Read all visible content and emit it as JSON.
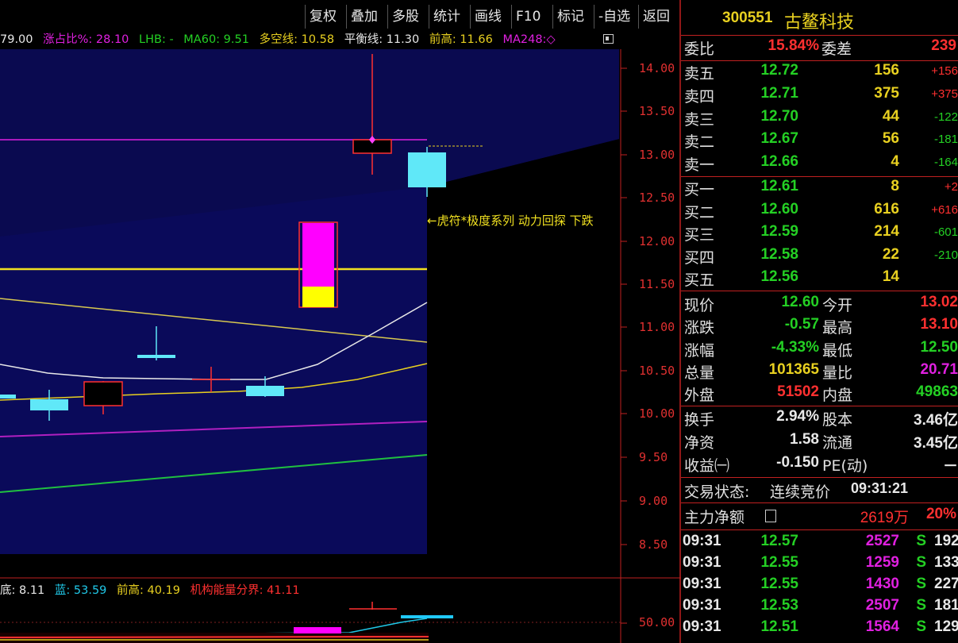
{
  "toolbar": [
    "复权",
    "叠加",
    "多股",
    "统计",
    "画线",
    "F10",
    "标记",
    "-自选",
    "返回"
  ],
  "indicator_top": [
    {
      "text": "79.00",
      "color": "#e8e8e8"
    },
    {
      "text": "涨占比%: 28.10",
      "color": "#e020e0"
    },
    {
      "text": "LHB: -",
      "color": "#24d024"
    },
    {
      "text": "MA60: 9.51",
      "color": "#24d024"
    },
    {
      "text": "多空线: 10.58",
      "color": "#e8d020"
    },
    {
      "text": "平衡线: 11.30",
      "color": "#e8e8e8"
    },
    {
      "text": "前高: 11.66",
      "color": "#e8d020"
    },
    {
      "text": "MA248:◇",
      "color": "#e020e0"
    }
  ],
  "price_ticks": [
    "14.00",
    "13.50",
    "13.00",
    "12.50",
    "12.00",
    "11.50",
    "11.00",
    "10.50",
    "10.00",
    "9.50",
    "9.00",
    "8.50"
  ],
  "lower_tick": "50.00",
  "annotation": "←虎符*极度系列 动力回探 下跌",
  "indicator_bottom": [
    {
      "text": "底: 8.11",
      "color": "#e8e8e8"
    },
    {
      "text": "蓝: 53.59",
      "color": "#20c8e8"
    },
    {
      "text": "前高: 40.19",
      "color": "#e8d020"
    },
    {
      "text": "机构能量分界: 41.11",
      "color": "#ff3030"
    }
  ],
  "stock": {
    "code": "300551",
    "name": "古鳌科技"
  },
  "weibi": {
    "label1": "委比",
    "value1": "15.84%",
    "label2": "委差",
    "value2": "239"
  },
  "sell": [
    {
      "label": "卖五",
      "price": "12.72",
      "vol": "156",
      "chg": "+156"
    },
    {
      "label": "卖四",
      "price": "12.71",
      "vol": "375",
      "chg": "+375"
    },
    {
      "label": "卖三",
      "price": "12.70",
      "vol": "44",
      "chg": "-122"
    },
    {
      "label": "卖二",
      "price": "12.67",
      "vol": "56",
      "chg": "-181"
    },
    {
      "label": "卖一",
      "price": "12.66",
      "vol": "4",
      "chg": "-164"
    }
  ],
  "buy": [
    {
      "label": "买一",
      "price": "12.61",
      "vol": "8",
      "chg": "+2"
    },
    {
      "label": "买二",
      "price": "12.60",
      "vol": "616",
      "chg": "+616"
    },
    {
      "label": "买三",
      "price": "12.59",
      "vol": "214",
      "chg": "-601"
    },
    {
      "label": "买四",
      "price": "12.58",
      "vol": "22",
      "chg": "-210"
    },
    {
      "label": "买五",
      "price": "12.56",
      "vol": "14",
      "chg": ""
    }
  ],
  "stats": [
    {
      "l1": "现价",
      "v1": "12.60",
      "c1": "green",
      "l2": "今开",
      "v2": "13.02",
      "c2": "red"
    },
    {
      "l1": "涨跌",
      "v1": "-0.57",
      "c1": "green",
      "l2": "最高",
      "v2": "13.10",
      "c2": "red"
    },
    {
      "l1": "涨幅",
      "v1": "-4.33%",
      "c1": "green",
      "l2": "最低",
      "v2": "12.50",
      "c2": "green"
    },
    {
      "l1": "总量",
      "v1": "101365",
      "c1": "yellow",
      "l2": "量比",
      "v2": "20.71",
      "c2": "magenta"
    },
    {
      "l1": "外盘",
      "v1": "51502",
      "c1": "red",
      "l2": "内盘",
      "v2": "49863",
      "c2": "green"
    }
  ],
  "fund": [
    {
      "l1": "换手",
      "v1": "2.94%",
      "l2": "股本",
      "v2": "3.46亿"
    },
    {
      "l1": "净资",
      "v1": "1.58",
      "l2": "流通",
      "v2": "3.45亿"
    },
    {
      "l1": "收益㈠",
      "v1": "-0.150",
      "l2": "PE(动)",
      "v2": "－"
    }
  ],
  "trade_status": {
    "label": "交易状态:",
    "value": "连续竞价",
    "time": "09:31:21"
  },
  "main_net": {
    "label": "主力净额",
    "value": "2619万",
    "pct": "20%"
  },
  "ticks": [
    {
      "time": "09:31",
      "price": "12.57",
      "vol": "2527",
      "side": "S",
      "extra": "192"
    },
    {
      "time": "09:31",
      "price": "12.55",
      "vol": "1259",
      "side": "S",
      "extra": "133"
    },
    {
      "time": "09:31",
      "price": "12.55",
      "vol": "1430",
      "side": "S",
      "extra": "227"
    },
    {
      "time": "09:31",
      "price": "12.53",
      "vol": "2507",
      "side": "S",
      "extra": "181"
    },
    {
      "time": "09:31",
      "price": "12.51",
      "vol": "1564",
      "side": "S",
      "extra": "129"
    }
  ]
}
